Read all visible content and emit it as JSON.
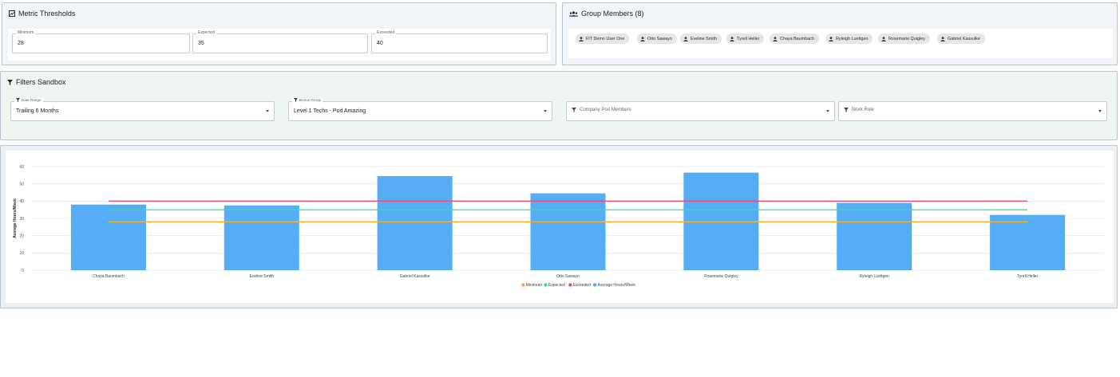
{
  "thresholds": {
    "title": "Metric Thresholds",
    "fields": [
      {
        "label": "Minimum",
        "value": "28"
      },
      {
        "label": "Expected",
        "value": "35"
      },
      {
        "label": "Exceeded",
        "value": "40"
      }
    ]
  },
  "group": {
    "title": "Group Members (8)",
    "members": [
      "FIT Demo User One",
      "Otto Sawayn",
      "Eveline Smith",
      "Tyrell Heller",
      "Chaya Baumbach",
      "Ryleigh Luettgen",
      "Rosemarie Quigley",
      "Gabriel Kassulke"
    ]
  },
  "filters": {
    "title": "Filters Sandbox",
    "date_range": {
      "label": "Date Range",
      "value": "Trailing 6 Months"
    },
    "bonus_group": {
      "label": "Bonus Group",
      "value": "Level 1 Techs - Pod Amazing"
    },
    "pod_members": {
      "placeholder": "Company Pod Members"
    },
    "work_role": {
      "placeholder": "Work Role"
    }
  },
  "colors": {
    "bar": "#55adf6",
    "minimum": "#f5b12e",
    "expected": "#3fd9a6",
    "exceeded": "#ee4d6a"
  },
  "chart_data": {
    "type": "bar",
    "ylabel": "Average Hours/Week",
    "ylim": [
      0,
      60
    ],
    "yticks": [
      0,
      10,
      20,
      30,
      40,
      50,
      60
    ],
    "grid": true,
    "legend": "bottom-center",
    "categories": [
      "Chaya Baumbach",
      "Eveline Smith",
      "Gabriel Kassulke",
      "Otto Sawayn",
      "Rosemarie Quigley",
      "Ryleigh Luettgen",
      "Tyrell Heller"
    ],
    "series": [
      {
        "name": "Minimum",
        "type": "line",
        "color_key": "minimum",
        "values": [
          28,
          28,
          28,
          28,
          28,
          28,
          28
        ]
      },
      {
        "name": "Expected",
        "type": "line",
        "color_key": "expected",
        "values": [
          35,
          35,
          35,
          35,
          35,
          35,
          35
        ]
      },
      {
        "name": "Exceeded",
        "type": "line",
        "color_key": "exceeded",
        "values": [
          40,
          40,
          40,
          40,
          40,
          40,
          40
        ]
      },
      {
        "name": "Average Hours/Week",
        "type": "bar",
        "color_key": "bar",
        "values": [
          38,
          37.5,
          54.5,
          44.5,
          56.5,
          39,
          32
        ]
      }
    ]
  }
}
